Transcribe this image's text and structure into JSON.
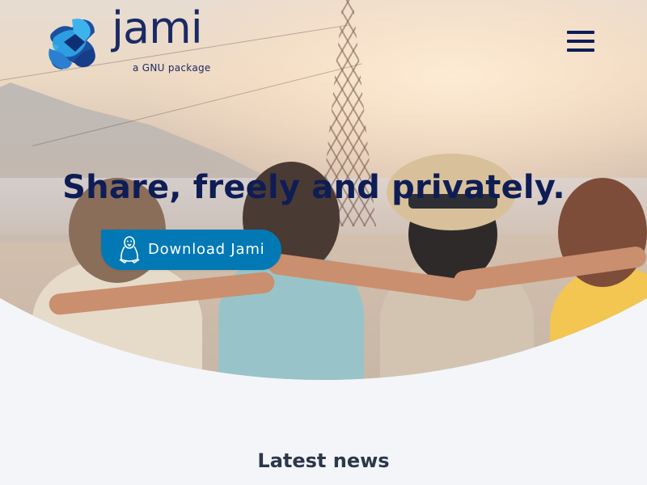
{
  "brand": {
    "name": "jami",
    "tagline": "a GNU package",
    "colors": {
      "primary": "#0279b5",
      "navy": "#0f1d55",
      "logo_blue_light": "#2ea6e8",
      "logo_blue_dark": "#163c8a",
      "background": "#f3f5f9"
    }
  },
  "header": {
    "menu_icon": "hamburger-menu-icon"
  },
  "hero": {
    "headline": "Share, freely and privately.",
    "download_label": "Download Jami",
    "download_icon": "linux-penguin-icon",
    "image_description_icon": "hero-photo"
  },
  "news": {
    "title": "Latest news"
  }
}
